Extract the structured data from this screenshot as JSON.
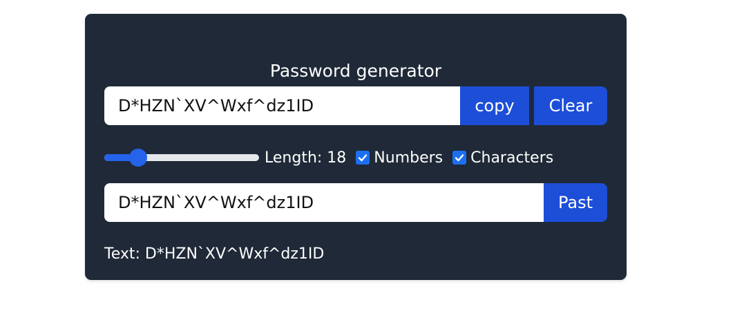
{
  "app": {
    "title": "Password generator"
  },
  "generator": {
    "password_value": "D*HZN`XV^Wxf^dz1ID",
    "copy_label": "copy",
    "clear_label": "Clear"
  },
  "options": {
    "length_text": "Length: 18",
    "length_value": 18,
    "slider_fraction": 0.18,
    "numbers_label": "Numbers",
    "numbers_checked": true,
    "characters_label": "Characters",
    "characters_checked": true
  },
  "paste": {
    "input_value": "D*HZN`XV^Wxf^dz1ID",
    "past_label": "Past"
  },
  "result": {
    "text_line": "Text: D*HZN`XV^Wxf^dz1ID"
  },
  "colors": {
    "card_bg": "#1f2937",
    "button_bg": "#1d4ed8",
    "accent": "#2563eb"
  }
}
